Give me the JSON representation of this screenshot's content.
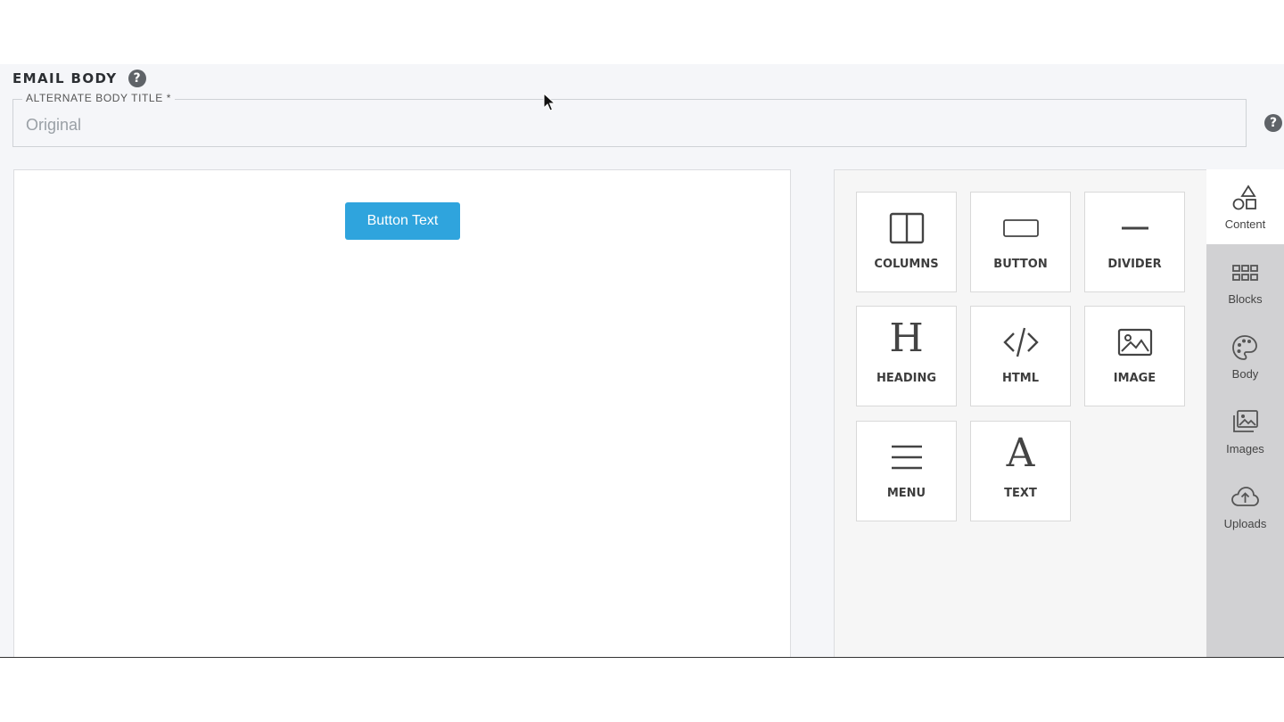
{
  "section": {
    "title": "EMAIL BODY"
  },
  "field": {
    "label": "ALTERNATE BODY TITLE *",
    "placeholder": "Original"
  },
  "canvas": {
    "button_label": "Button Text",
    "button_color": "#2fa4dd"
  },
  "tools": [
    {
      "label": "COLUMNS",
      "icon": "columns-icon"
    },
    {
      "label": "BUTTON",
      "icon": "button-icon"
    },
    {
      "label": "DIVIDER",
      "icon": "divider-icon"
    },
    {
      "label": "HEADING",
      "icon": "heading-icon"
    },
    {
      "label": "HTML",
      "icon": "code-icon"
    },
    {
      "label": "IMAGE",
      "icon": "image-icon"
    },
    {
      "label": "MENU",
      "icon": "menu-icon"
    },
    {
      "label": "TEXT",
      "icon": "text-icon"
    }
  ],
  "sidebar": {
    "active": "Content",
    "tabs": [
      {
        "label": "Content",
        "icon": "shapes-icon"
      },
      {
        "label": "Blocks",
        "icon": "grid-icon"
      },
      {
        "label": "Body",
        "icon": "palette-icon"
      },
      {
        "label": "Images",
        "icon": "images-icon"
      },
      {
        "label": "Uploads",
        "icon": "cloud-upload-icon"
      }
    ]
  }
}
